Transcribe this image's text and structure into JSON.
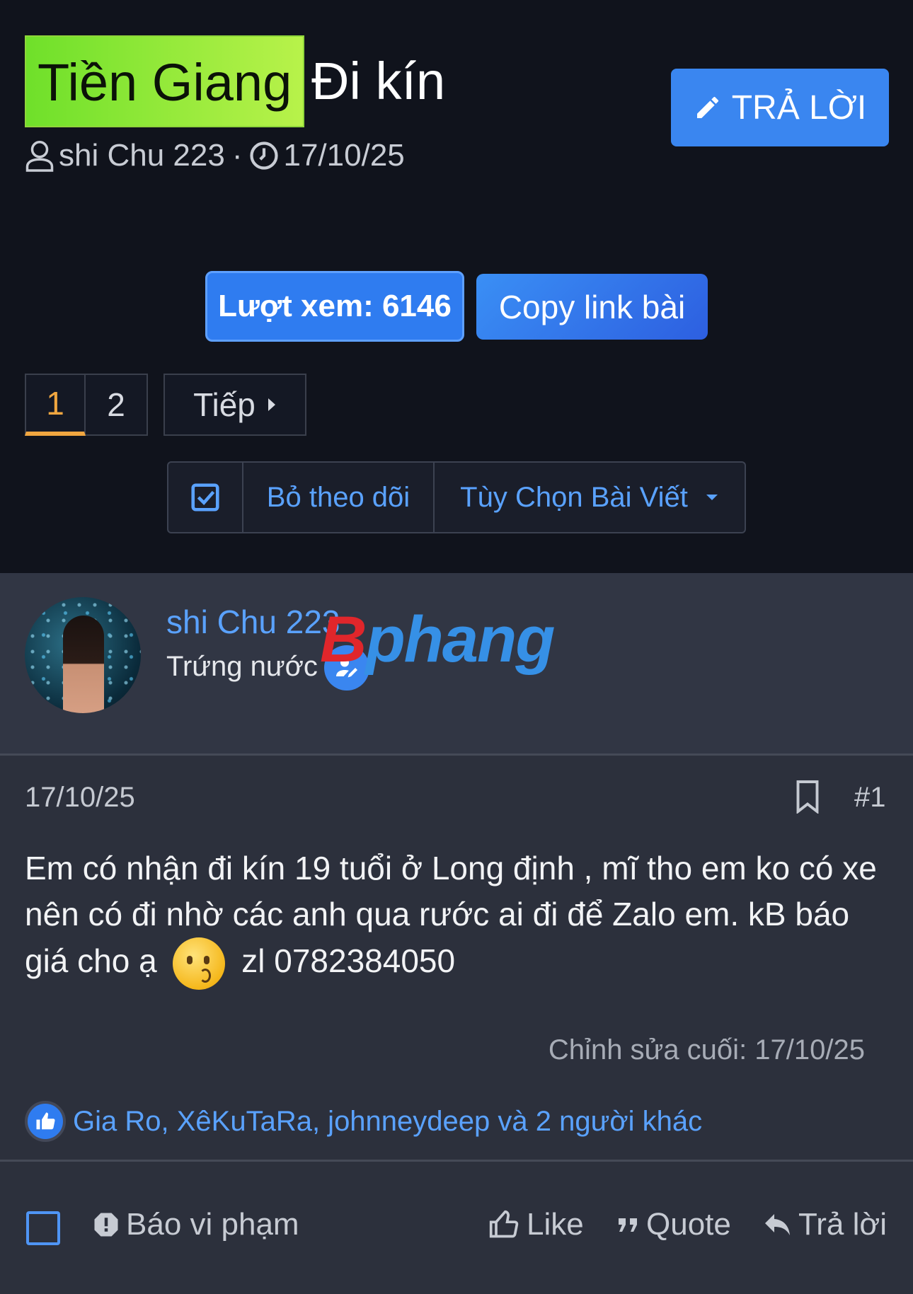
{
  "thread": {
    "prefix": "Tiền Giang",
    "title": "Đi kín",
    "author": "shi Chu 223",
    "separator": "·",
    "date": "17/10/25"
  },
  "header": {
    "reply_button": "TRẢ LỜI",
    "views_label": "Lượt xem: 6146",
    "copy_link_label": "Copy link bài"
  },
  "pagination": {
    "pages": [
      "1",
      "2"
    ],
    "current": "1",
    "next_label": "Tiếp"
  },
  "thread_actions": {
    "unfollow_label": "Bỏ theo dõi",
    "options_label": "Tùy Chọn Bài Viết"
  },
  "post": {
    "author_name": "shi Chu 223",
    "author_role": "Trứng nước",
    "watermark_b": "B",
    "watermark_rest": "phang",
    "date": "17/10/25",
    "number": "#1",
    "body_line1": "Em có nhận đi kín 19 tuổi ở Long định , mĩ tho em ko có xe nên có đi nhờ các anh qua rước ai đi để Zalo em. kB báo giá cho ạ",
    "body_line2": "zl 0782384050",
    "edited": "Chỉnh sửa cuối: 17/10/25",
    "likes_text": "Gia Ro, XêKuTaRa, johnneydeep và 2 người khác"
  },
  "post_footer": {
    "report_label": "Báo vi phạm",
    "like_label": "Like",
    "quote_label": "Quote",
    "reply_label": "Trả lời"
  },
  "colors": {
    "background": "#10131c",
    "post_background": "#2c303c",
    "accent_blue": "#3a86f0",
    "link_blue": "#5aa2ff",
    "prefix_green": "#8fe63a",
    "current_page_orange": "#f0a640"
  }
}
